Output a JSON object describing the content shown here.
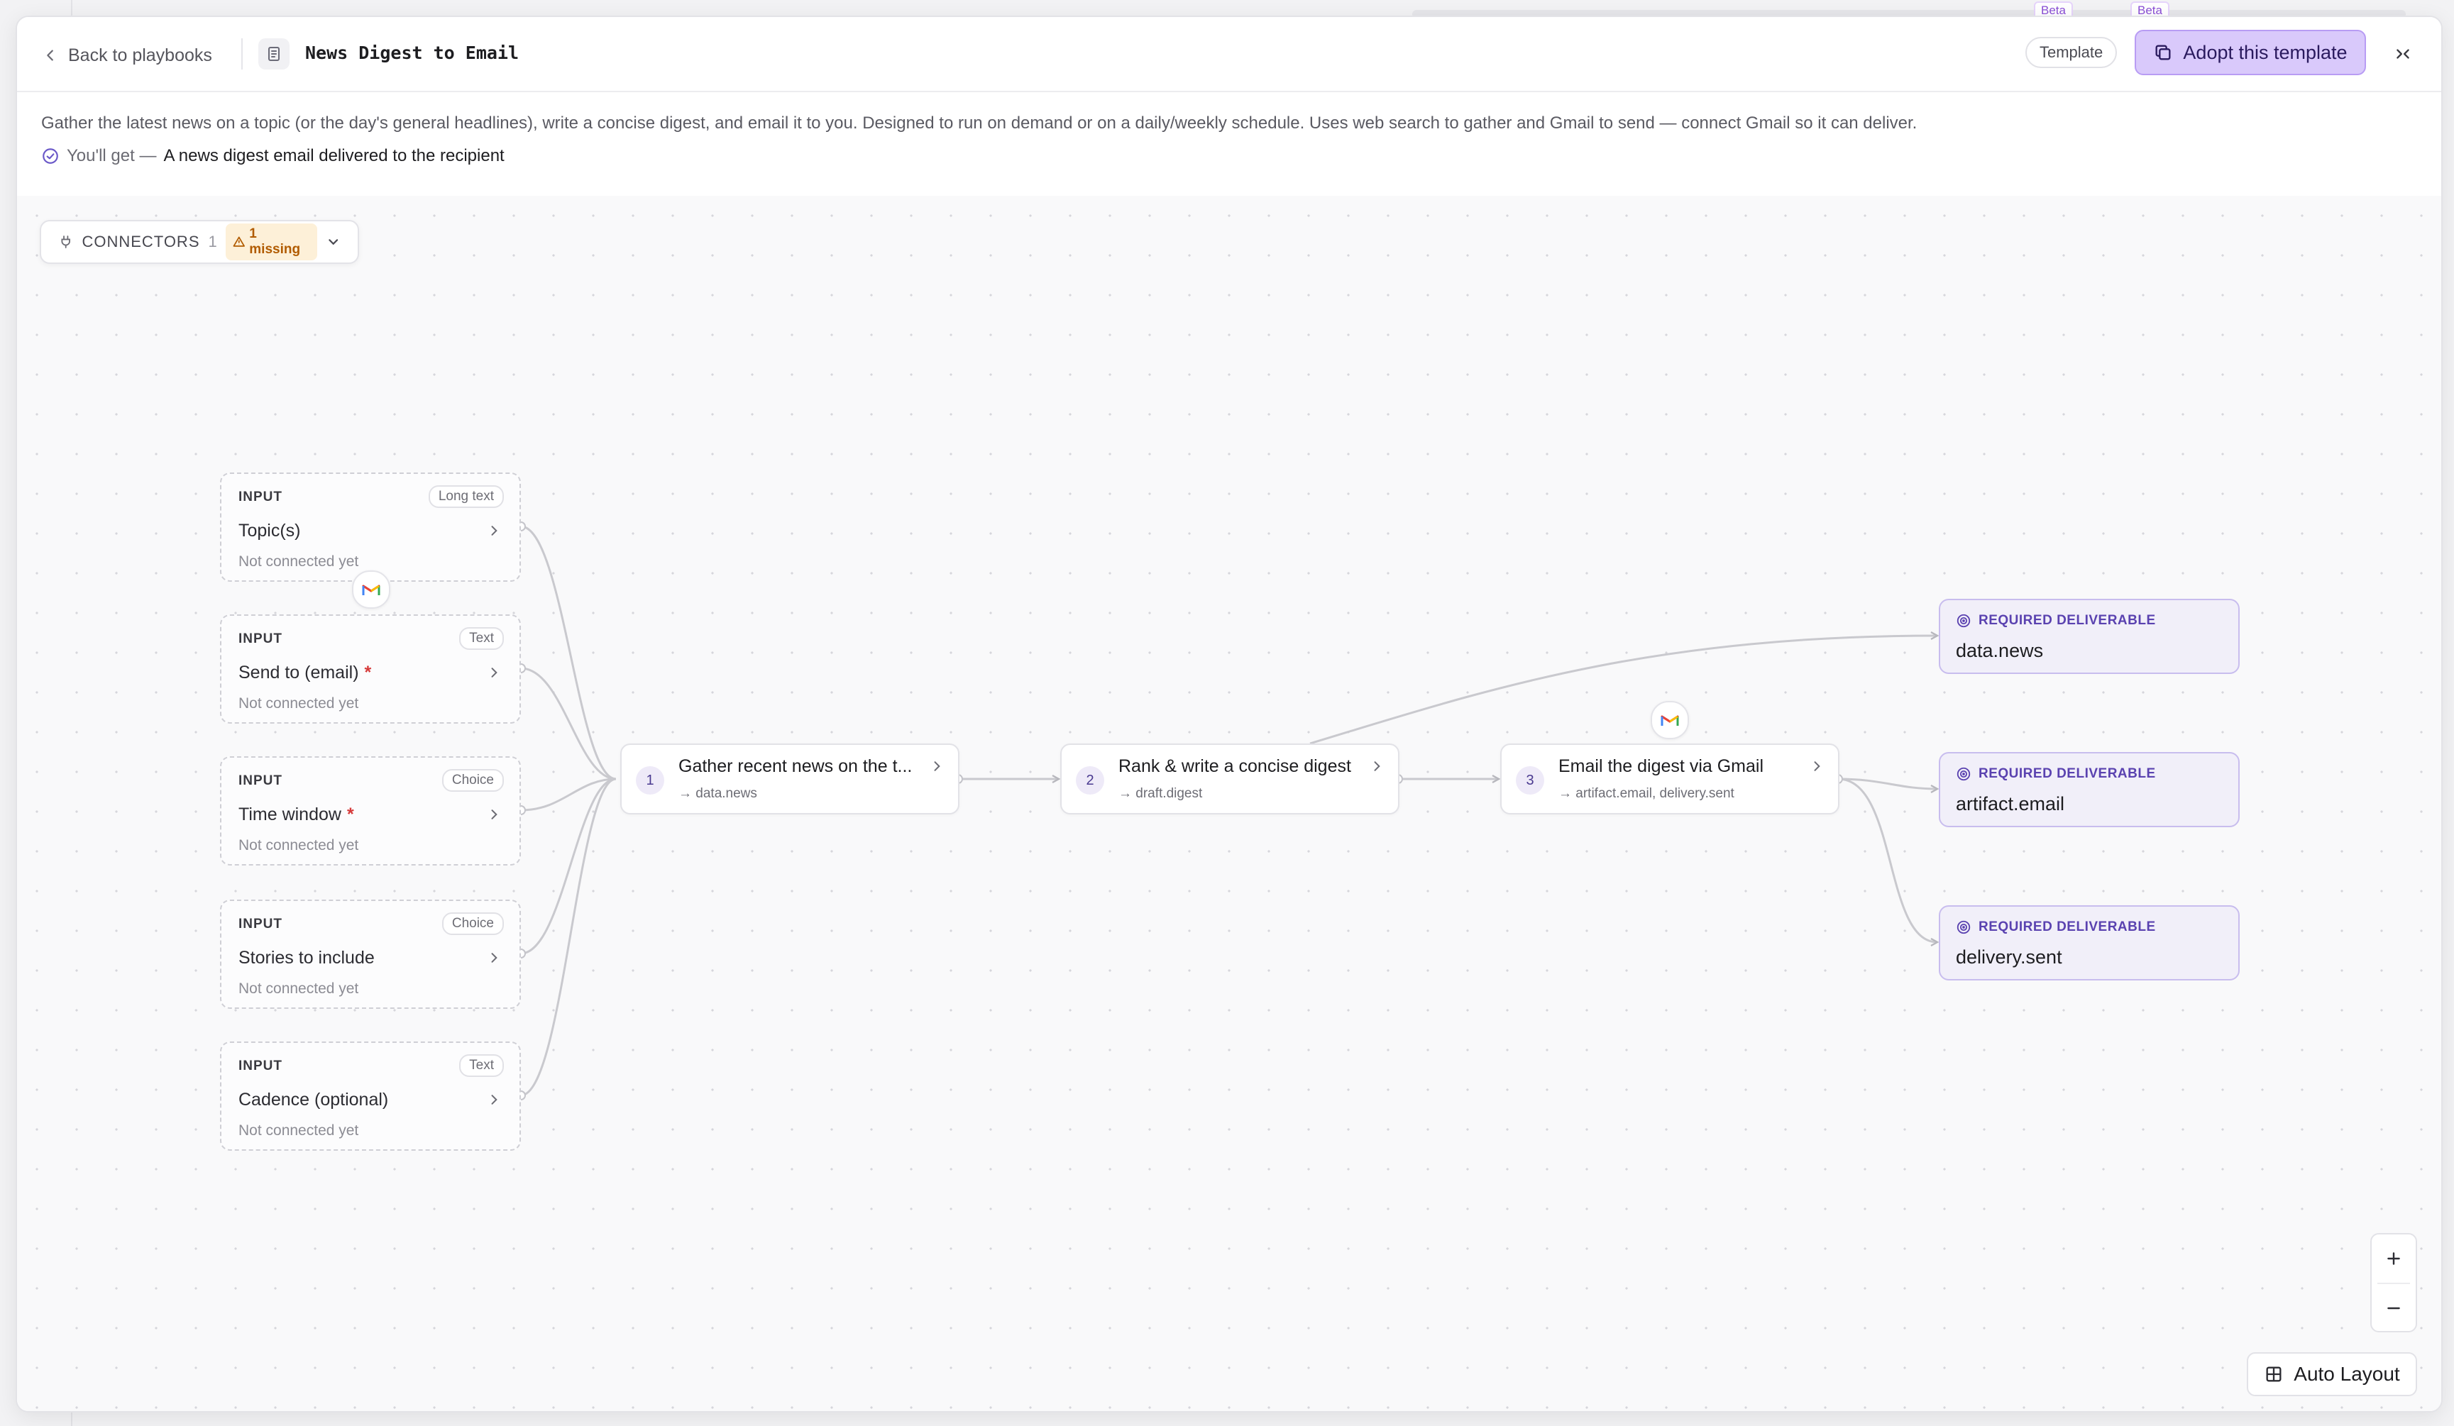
{
  "background": {
    "beta_labels": [
      "Beta",
      "Beta"
    ]
  },
  "header": {
    "back_label": "Back to playbooks",
    "title": "News Digest to Email",
    "template_badge": "Template",
    "adopt_label": "Adopt this template"
  },
  "summary": {
    "description": "Gather the latest news on a topic (or the day's general headlines), write a concise digest, and email it to you. Designed to run on demand or on a daily/weekly schedule. Uses web search to gather and Gmail to send — connect Gmail so it can deliver.",
    "you_get_label": "You'll get —",
    "you_get_value": "A news digest email delivered to the recipient"
  },
  "connectors": {
    "label": "CONNECTORS",
    "count": "1",
    "missing": "1 missing"
  },
  "inputs": [
    {
      "kind": "INPUT",
      "type": "Long text",
      "label": "Topic(s)",
      "required": false,
      "status": "Not connected yet"
    },
    {
      "kind": "INPUT",
      "type": "Text",
      "label": "Send to (email)",
      "required": true,
      "status": "Not connected yet"
    },
    {
      "kind": "INPUT",
      "type": "Choice",
      "label": "Time window",
      "required": true,
      "status": "Not connected yet"
    },
    {
      "kind": "INPUT",
      "type": "Choice",
      "label": "Stories to include",
      "required": false,
      "status": "Not connected yet"
    },
    {
      "kind": "INPUT",
      "type": "Text",
      "label": "Cadence (optional)",
      "required": false,
      "status": "Not connected yet"
    }
  ],
  "required_marker": "*",
  "steps": [
    {
      "num": "1",
      "title": "Gather recent news on the t...",
      "outputs": "→ data.news"
    },
    {
      "num": "2",
      "title": "Rank & write a concise digest",
      "outputs": "→ draft.digest"
    },
    {
      "num": "3",
      "title": "Email the digest via Gmail",
      "outputs": "→ artifact.email, delivery.sent"
    }
  ],
  "deliverables": [
    {
      "tag": "REQUIRED DELIVERABLE",
      "name": "data.news"
    },
    {
      "tag": "REQUIRED DELIVERABLE",
      "name": "artifact.email"
    },
    {
      "tag": "REQUIRED DELIVERABLE",
      "name": "delivery.sent"
    }
  ],
  "controls": {
    "auto_layout": "Auto Layout"
  },
  "icons": {
    "back": "chevron-left-icon",
    "doc": "document-icon",
    "adopt": "copy-icon",
    "collapse": "collapse-icon",
    "you_get": "check-circle-icon",
    "connectors": "plug-icon",
    "missing": "warning-icon",
    "gmail": "gmail-icon",
    "deliverable": "target-icon",
    "zoom_in": "plus-icon",
    "zoom_out": "minus-icon",
    "auto_layout": "grid-icon"
  },
  "colors": {
    "accent": "#d9c9fb",
    "accent_border": "#b89cf4",
    "deliverable_bg": "#f1eff9",
    "required": "#d63a3a",
    "warning": "#b15b00"
  }
}
